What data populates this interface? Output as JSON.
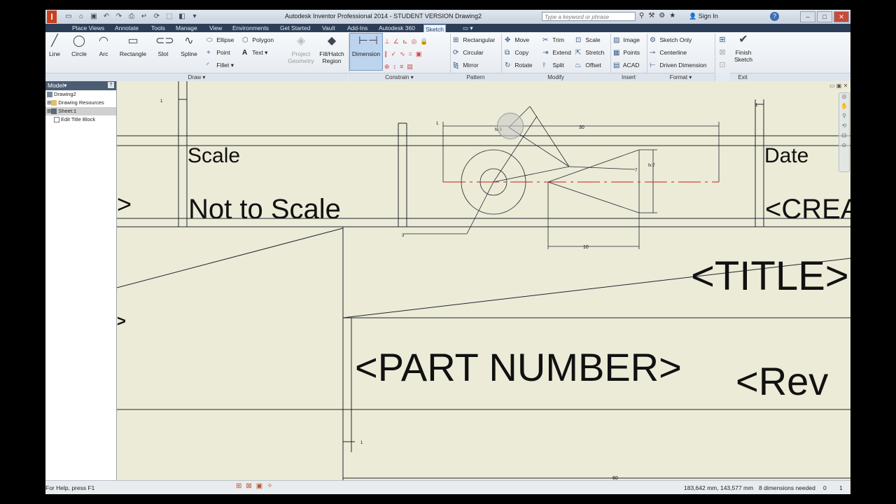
{
  "titlebar": {
    "logo": "I",
    "title": "Autodesk Inventor Professional 2014 - STUDENT VERSION    Drawing2",
    "search_placeholder": "Type a keyword or phrase",
    "signin": "Sign In",
    "help": "?"
  },
  "tabs": [
    "Place Views",
    "Annotate",
    "Tools",
    "Manage",
    "View",
    "Environments",
    "Get Started",
    "Vault",
    "Add-Ins",
    "Autodesk 360",
    "Sketch"
  ],
  "active_tab": "Sketch",
  "ribbon": {
    "draw": {
      "label": "Draw",
      "line": "Line",
      "circle": "Circle",
      "arc": "Arc",
      "rectangle": "Rectangle",
      "slot": "Slot",
      "spline": "Spline",
      "ellipse": "Ellipse",
      "point": "Point",
      "fillet": "Fillet",
      "polygon": "Polygon",
      "text": "Text",
      "project_geometry_1": "Project",
      "project_geometry_2": "Geometry",
      "fill_hatch_1": "Fill/Hatch",
      "fill_hatch_2": "Region"
    },
    "constrain": {
      "label": "Constrain",
      "dimension": "Dimension"
    },
    "pattern": {
      "label": "Pattern",
      "rectangular": "Rectangular",
      "circular": "Circular",
      "mirror": "Mirror"
    },
    "modify": {
      "label": "Modify",
      "move": "Move",
      "copy": "Copy",
      "rotate": "Rotate",
      "trim": "Trim",
      "extend": "Extend",
      "split": "Split",
      "scale": "Scale",
      "stretch": "Stretch",
      "offset": "Offset"
    },
    "insert": {
      "label": "Insert",
      "image": "Image",
      "points": "Points",
      "acad": "ACAD"
    },
    "format": {
      "label": "Format",
      "sketch_only": "Sketch Only",
      "centerline": "Centerline",
      "driven_dimension": "Driven Dimension"
    },
    "exit": {
      "label": "Exit",
      "finish_1": "Finish",
      "finish_2": "Sketch"
    }
  },
  "browser": {
    "header": "Model",
    "items": [
      "Drawing2",
      "Drawing Resources",
      "Sheet:1",
      "Edit Title Block"
    ]
  },
  "drawing": {
    "scale_label": "Scale",
    "scale_value": "Not to Scale",
    "date_label": "Date",
    "date_value": "<CREA",
    "title": "<TITLE>",
    "part_number": "<PART NUMBER>",
    "revision": "<Rev",
    "left_chevron": ">",
    "left_chevron2": ">",
    "dim_30": "30",
    "dim_10": "10",
    "dim_60": "60",
    "dim_1a": "1",
    "dim_1b": "1",
    "dim_1c": "1",
    "dim_1d": "1",
    "dim_3": "3",
    "dim_7": "7",
    "fx3": "fx:3",
    "fx7": "fx:7"
  },
  "status": {
    "help": "For Help, press F1",
    "coords": "183,642 mm, 143,577 mm",
    "dims_needed": "8 dimensions needed",
    "n0": "0",
    "n1": "1"
  },
  "colors": {
    "canvas_bg": "#ecebd7",
    "line": "#1f2430",
    "center_line": "#c0201a",
    "tab_bar": "#2c3e57",
    "browser_header": "#4b5d73"
  }
}
